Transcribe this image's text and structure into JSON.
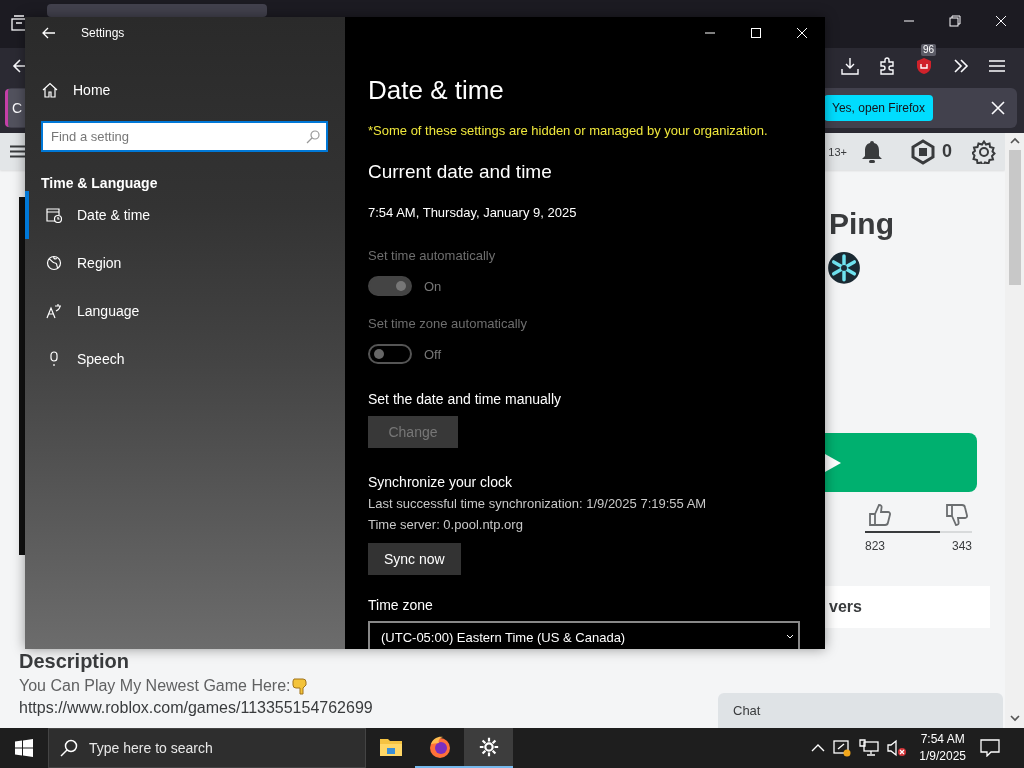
{
  "browser": {
    "extensions_badge": "96",
    "notification_bar": {
      "partial_button": "C",
      "open_button": "Yes, open Firefox"
    },
    "page_header": {
      "age_rating": "13+",
      "robux_balance": "0"
    },
    "game": {
      "title": "Ping",
      "upvotes": "823",
      "downvotes": "343",
      "vote_bar": {
        "level": 0.7
      },
      "servers_tab": "vers"
    },
    "description": {
      "heading": "Description",
      "text": "You Can Play My Newest Game Here:",
      "link": "https://www.roblox.com/games/113355154762699"
    },
    "chat": {
      "label": "Chat"
    }
  },
  "settings_window": {
    "title": "Settings",
    "home": "Home",
    "search": {
      "placeholder": "Find a setting"
    },
    "section": "Time & Language",
    "nav_items": [
      {
        "label": "Date & time",
        "kind": "clock",
        "selected": true
      },
      {
        "label": "Region",
        "kind": "globe",
        "selected": false
      },
      {
        "label": "Language",
        "kind": "language",
        "selected": false
      },
      {
        "label": "Speech",
        "kind": "mic",
        "selected": false
      }
    ]
  },
  "date_time_page": {
    "title": "Date & time",
    "managed_notice": "*Some of these settings are hidden or managed by your organization.",
    "current_heading": "Current date and time",
    "current_value": "7:54 AM, Thursday, January 9, 2025",
    "toggles": [
      {
        "label": "Set time automatically",
        "state_text": "On",
        "on": true,
        "disabled": true
      },
      {
        "label": "Set time zone automatically",
        "state_text": "Off",
        "on": false,
        "disabled": true
      }
    ],
    "manual": {
      "label": "Set the date and time manually",
      "button": {
        "label": "Change",
        "disabled": true
      }
    },
    "sync": {
      "heading": "Synchronize your clock",
      "last_sync": "Last successful time synchronization: 1/9/2025 7:19:55 AM",
      "time_server": "Time server: 0.pool.ntp.org",
      "button": "Sync now"
    },
    "time_zone": {
      "label": "Time zone",
      "value": "(UTC-05:00) Eastern Time (US & Canada)"
    }
  },
  "taskbar": {
    "search": {
      "placeholder": "Type here to search"
    },
    "apps": [
      {
        "kind": "folder",
        "running": false,
        "active": false
      },
      {
        "kind": "firefox",
        "running": true,
        "active": false
      },
      {
        "kind": "gear",
        "running": true,
        "active": true
      }
    ],
    "clock": {
      "time": "7:54 AM",
      "date": "1/9/2025"
    }
  }
}
